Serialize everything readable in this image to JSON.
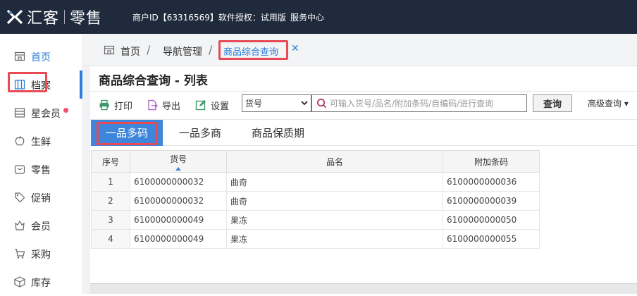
{
  "topbar": {
    "brand": "汇客",
    "sub": "零售",
    "merchant": "商户ID【63316569】软件授权：试用版",
    "service": "服务中心"
  },
  "sidebar": {
    "items": [
      {
        "label": "首页",
        "icon": "home-icon"
      },
      {
        "label": "档案",
        "icon": "archive-icon"
      },
      {
        "label": "星会员",
        "icon": "star-member-icon"
      },
      {
        "label": "生鲜",
        "icon": "apple-icon"
      },
      {
        "label": "零售",
        "icon": "retail-icon"
      },
      {
        "label": "促销",
        "icon": "tag-icon"
      },
      {
        "label": "会员",
        "icon": "member-icon"
      },
      {
        "label": "采购",
        "icon": "cart-icon"
      },
      {
        "label": "库存",
        "icon": "inventory-icon"
      }
    ]
  },
  "breadcrumb": {
    "home": "首页",
    "nav": "导航管理",
    "current": "商品综合查询",
    "sep": "/"
  },
  "page": {
    "title": "商品综合查询 - 列表"
  },
  "toolbar": {
    "print": "打印",
    "export": "导出",
    "settings": "设置",
    "field_select": "货号",
    "search_placeholder": "可输入货号/品名/附加条码/自编码/进行查询",
    "query": "查询",
    "advanced": "高级查询 ▾"
  },
  "tabs": [
    "一品多码",
    "一品多商",
    "商品保质期"
  ],
  "table": {
    "headers": [
      "序号",
      "货号",
      "品名",
      "附加条码"
    ],
    "rows": [
      [
        "1",
        "6100000000032",
        "曲奇",
        "6100000000036"
      ],
      [
        "2",
        "6100000000032",
        "曲奇",
        "6100000000039"
      ],
      [
        "3",
        "6100000000049",
        "果冻",
        "6100000000050"
      ],
      [
        "4",
        "6100000000049",
        "果冻",
        "6100000000055"
      ]
    ]
  },
  "colors": {
    "accent": "#2b7fd8",
    "topbar": "#1f2a3c",
    "highlight": "#e84a56",
    "tab_active": "#3e86dc"
  }
}
